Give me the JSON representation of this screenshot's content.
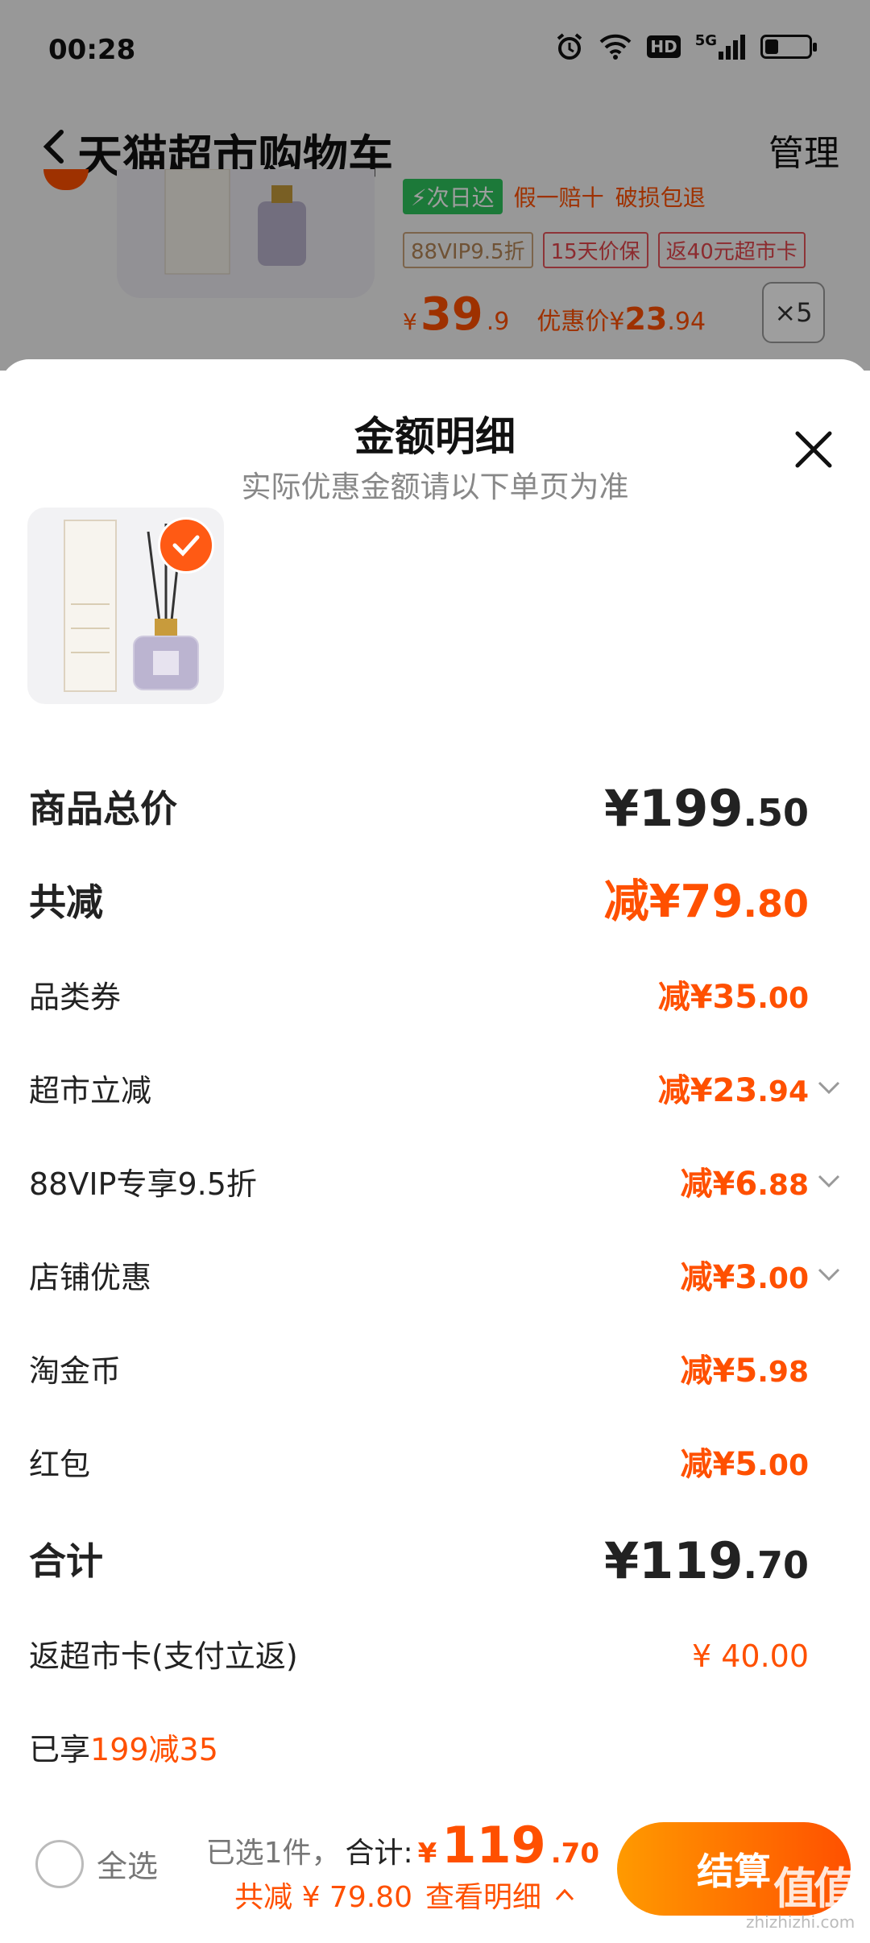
{
  "status_bar": {
    "time": "00:28",
    "icons": [
      "alarm-icon",
      "wifi-icon",
      "hd-icon",
      "5g-signal-icon",
      "battery-icon"
    ],
    "hd_label": "HD",
    "net_label": "5G",
    "battery_level": 0.3
  },
  "nav": {
    "title": "天猫超市购物车",
    "manage_label": "管理"
  },
  "cart_item": {
    "tag_delivery": "⚡次日达",
    "tag_guarantee1": "假一赔十",
    "tag_guarantee2": "破损包退",
    "tag_vip": "88VIP9.5折",
    "tag_price_protect": "15天价保",
    "tag_card": "返40元超市卡",
    "price_currency": "¥",
    "price_int": "39",
    "price_dec": ".9",
    "promo_label": "优惠价¥",
    "promo_int": "23",
    "promo_dec": ".94",
    "quantity": "×5"
  },
  "sheet": {
    "title": "金额明细",
    "subtitle": "实际优惠金额请以下单页为准",
    "rows": {
      "total": {
        "label": "商品总价",
        "int": "¥199",
        "dec": ".50"
      },
      "discount_total": {
        "label": "共减",
        "int": "减¥79",
        "dec": ".80"
      },
      "category_coupon": {
        "label": "品类券",
        "int": "减¥35",
        "dec": ".00"
      },
      "supermarket_off": {
        "label": "超市立减",
        "int": "减¥23",
        "dec": ".94"
      },
      "vip_off": {
        "label": "88VIP专享9.5折",
        "int": "减¥6",
        "dec": ".88"
      },
      "store_off": {
        "label": "店铺优惠",
        "int": "减¥3",
        "dec": ".00"
      },
      "coins": {
        "label": "淘金币",
        "int": "减¥5",
        "dec": ".98"
      },
      "red_packet": {
        "label": "红包",
        "int": "减¥5",
        "dec": ".00"
      },
      "sum": {
        "label": "合计",
        "int": "¥119",
        "dec": ".70"
      },
      "cashback": {
        "label": "返超市卡(支付立返)",
        "value": "¥ 40.00"
      },
      "enjoyed": {
        "label": "已享",
        "value": "199减35"
      }
    }
  },
  "bottom_bar": {
    "select_all": "全选",
    "selected_count": "已选1件，",
    "total_label": "合计:",
    "total_currency": "¥",
    "total_int": "119",
    "total_dec": ".70",
    "discount_text": "共减 ¥ 79.80",
    "detail_link": "查看明细",
    "checkout": "结算"
  },
  "watermark": {
    "logo": "值值值",
    "url": "zhizhizhi.com"
  },
  "colors": {
    "accent": "#ff5000",
    "overlay": "rgba(0,0,0,0.38)"
  }
}
